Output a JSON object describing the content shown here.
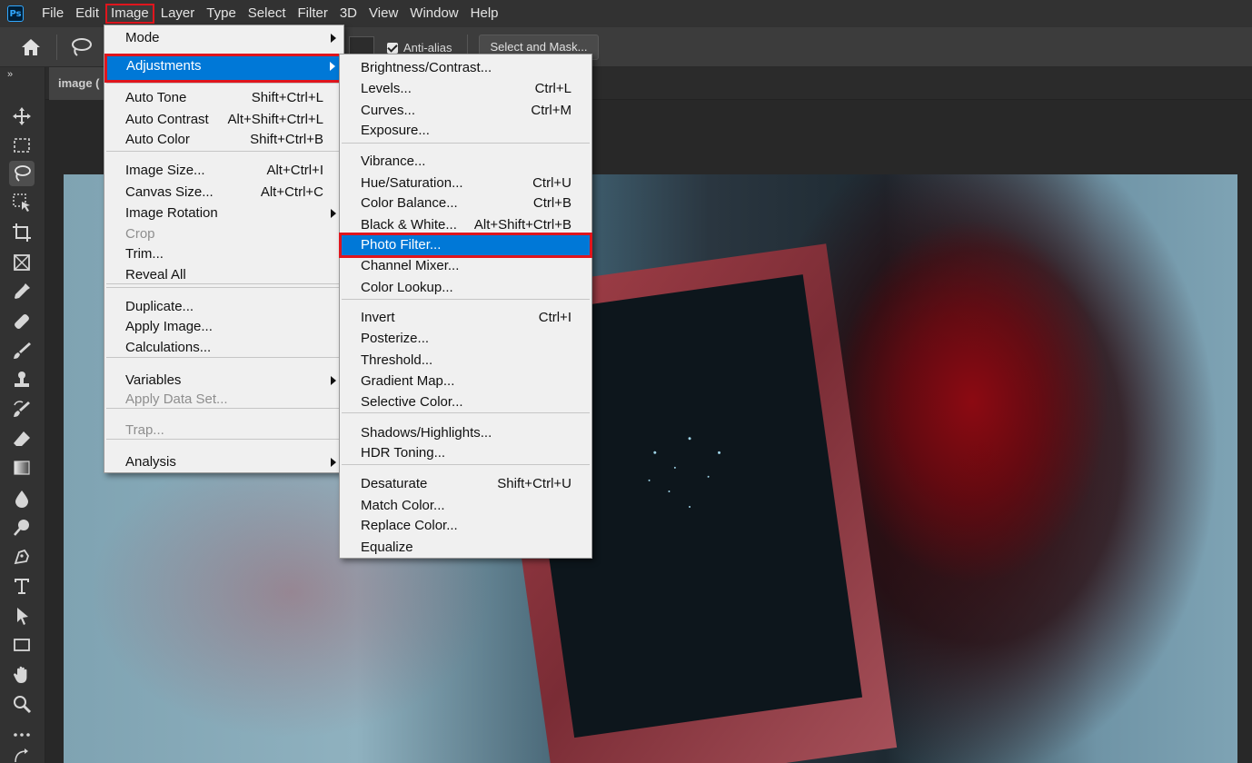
{
  "app": {
    "logo": "Ps"
  },
  "menubar": {
    "items": [
      "File",
      "Edit",
      "Image",
      "Layer",
      "Type",
      "Select",
      "Filter",
      "3D",
      "View",
      "Window",
      "Help"
    ],
    "active": "Image"
  },
  "options": {
    "antialias_label": "Anti-alias",
    "antialias_checked": true,
    "select_mask_label": "Select and Mask..."
  },
  "document": {
    "tab_label": "image ("
  },
  "panel": {
    "collapse_glyph": "»"
  },
  "image_menu": {
    "items": [
      {
        "label": "Mode",
        "shortcut": "",
        "submenu": true,
        "disabled": false,
        "highlight": false
      },
      {
        "label": "Adjustments",
        "shortcut": "",
        "submenu": true,
        "disabled": false,
        "highlight": true
      },
      {
        "label": "Auto Tone",
        "shortcut": "Shift+Ctrl+L",
        "submenu": false,
        "disabled": false,
        "highlight": false
      },
      {
        "label": "Auto Contrast",
        "shortcut": "Alt+Shift+Ctrl+L",
        "submenu": false,
        "disabled": false,
        "highlight": false
      },
      {
        "label": "Auto Color",
        "shortcut": "Shift+Ctrl+B",
        "submenu": false,
        "disabled": false,
        "highlight": false
      },
      {
        "label": "Image Size...",
        "shortcut": "Alt+Ctrl+I",
        "submenu": false,
        "disabled": false,
        "highlight": false
      },
      {
        "label": "Canvas Size...",
        "shortcut": "Alt+Ctrl+C",
        "submenu": false,
        "disabled": false,
        "highlight": false
      },
      {
        "label": "Image Rotation",
        "shortcut": "",
        "submenu": true,
        "disabled": false,
        "highlight": false
      },
      {
        "label": "Crop",
        "shortcut": "",
        "submenu": false,
        "disabled": true,
        "highlight": false
      },
      {
        "label": "Trim...",
        "shortcut": "",
        "submenu": false,
        "disabled": false,
        "highlight": false
      },
      {
        "label": "Reveal All",
        "shortcut": "",
        "submenu": false,
        "disabled": false,
        "highlight": false
      },
      {
        "label": "Duplicate...",
        "shortcut": "",
        "submenu": false,
        "disabled": false,
        "highlight": false
      },
      {
        "label": "Apply Image...",
        "shortcut": "",
        "submenu": false,
        "disabled": false,
        "highlight": false
      },
      {
        "label": "Calculations...",
        "shortcut": "",
        "submenu": false,
        "disabled": false,
        "highlight": false
      },
      {
        "label": "Variables",
        "shortcut": "",
        "submenu": true,
        "disabled": false,
        "highlight": false
      },
      {
        "label": "Apply Data Set...",
        "shortcut": "",
        "submenu": false,
        "disabled": true,
        "highlight": false
      },
      {
        "label": "Trap...",
        "shortcut": "",
        "submenu": false,
        "disabled": true,
        "highlight": false
      },
      {
        "label": "Analysis",
        "shortcut": "",
        "submenu": true,
        "disabled": false,
        "highlight": false
      }
    ]
  },
  "adjustments_menu": {
    "items": [
      {
        "label": "Brightness/Contrast...",
        "shortcut": "",
        "highlight": false
      },
      {
        "label": "Levels...",
        "shortcut": "Ctrl+L",
        "highlight": false
      },
      {
        "label": "Curves...",
        "shortcut": "Ctrl+M",
        "highlight": false
      },
      {
        "label": "Exposure...",
        "shortcut": "",
        "highlight": false
      },
      {
        "label": "Vibrance...",
        "shortcut": "",
        "highlight": false
      },
      {
        "label": "Hue/Saturation...",
        "shortcut": "Ctrl+U",
        "highlight": false
      },
      {
        "label": "Color Balance...",
        "shortcut": "Ctrl+B",
        "highlight": false
      },
      {
        "label": "Black & White...",
        "shortcut": "Alt+Shift+Ctrl+B",
        "highlight": false
      },
      {
        "label": "Photo Filter...",
        "shortcut": "",
        "highlight": true
      },
      {
        "label": "Channel Mixer...",
        "shortcut": "",
        "highlight": false
      },
      {
        "label": "Color Lookup...",
        "shortcut": "",
        "highlight": false
      },
      {
        "label": "Invert",
        "shortcut": "Ctrl+I",
        "highlight": false
      },
      {
        "label": "Posterize...",
        "shortcut": "",
        "highlight": false
      },
      {
        "label": "Threshold...",
        "shortcut": "",
        "highlight": false
      },
      {
        "label": "Gradient Map...",
        "shortcut": "",
        "highlight": false
      },
      {
        "label": "Selective Color...",
        "shortcut": "",
        "highlight": false
      },
      {
        "label": "Shadows/Highlights...",
        "shortcut": "",
        "highlight": false
      },
      {
        "label": "HDR Toning...",
        "shortcut": "",
        "highlight": false
      },
      {
        "label": "Desaturate",
        "shortcut": "Shift+Ctrl+U",
        "highlight": false
      },
      {
        "label": "Match Color...",
        "shortcut": "",
        "highlight": false
      },
      {
        "label": "Replace Color...",
        "shortcut": "",
        "highlight": false
      },
      {
        "label": "Equalize",
        "shortcut": "",
        "highlight": false
      }
    ]
  },
  "tools": [
    "move-tool-icon",
    "marquee-tool-icon",
    "lasso-tool-icon",
    "object-selection-tool-icon",
    "crop-tool-icon",
    "frame-tool-icon",
    "eyedropper-tool-icon",
    "healing-brush-tool-icon",
    "brush-tool-icon",
    "clone-stamp-tool-icon",
    "history-brush-tool-icon",
    "eraser-tool-icon",
    "gradient-tool-icon",
    "blur-tool-icon",
    "dodge-tool-icon",
    "pen-tool-icon",
    "type-tool-icon",
    "path-selection-tool-icon",
    "rectangle-tool-icon",
    "hand-tool-icon",
    "zoom-tool-icon",
    "more-tools-icon",
    "swap-colors-icon"
  ],
  "colors": {
    "highlight": "#0078d7",
    "annotation_outline": "#e0151d",
    "menu_bg": "#f0f0f0",
    "chrome_bg": "#323232"
  }
}
